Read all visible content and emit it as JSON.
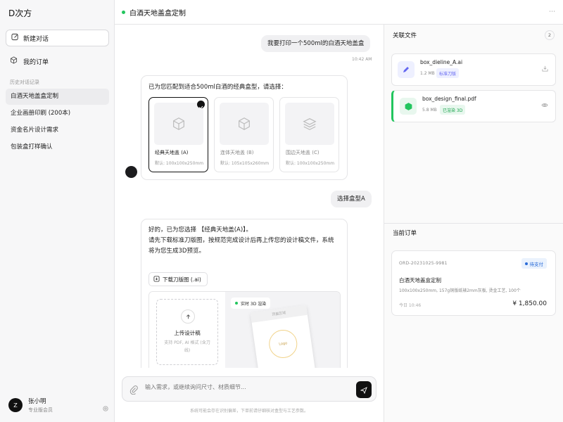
{
  "sidebar": {
    "brand": "D次方",
    "new_chat": "新建对话",
    "my_orders": "我的订单",
    "history_title": "历史对话记录",
    "history": [
      {
        "label": "白酒天地盖盒定制"
      },
      {
        "label": "企业画册印刷 (200本)"
      },
      {
        "label": "资金名片设计需求"
      },
      {
        "label": "包装盒打样确认"
      }
    ],
    "user": {
      "avatar": "Z",
      "name": "张小明",
      "role": "专业版会员"
    }
  },
  "header": {
    "title": "白酒天地盖盒定制",
    "more": "⋯"
  },
  "chat": {
    "user_msg_1": "我要打印一个500ml的白酒天地盖盒",
    "user_msg_1_time": "10:42 AM",
    "bot_msg_1": "已为您匹配到适合500ml白酒的经典盒型，请选择：",
    "options": [
      {
        "name": "经典天地盖 (A)",
        "dims": "默认: 100x100x250mm"
      },
      {
        "name": "连体天地盖 (B)",
        "dims": "默认: 105x105x260mm"
      },
      {
        "name": "围边天地盖 (C)",
        "dims": "默认: 100x100x250mm"
      }
    ],
    "user_msg_2": "选择盒型A",
    "bot_msg_2_line1": "好的，已为您选择 【经典天地盖(A)】。",
    "bot_msg_2_line2": "请先下载标准刀版图，按规范完成设计后再上传您的设计稿文件，系统",
    "bot_msg_2_line3": "将为您生成3D预览。",
    "download_label": "下载刀版图 (.ai)",
    "upload_title": "上传设计稿",
    "upload_sub": "支持 PDF, AI 格式 (含刀线)",
    "render_badge": "实时 3D 渲染",
    "box_top_text": "顶盖区域",
    "box_logo": "Logo"
  },
  "input": {
    "placeholder": "输入需求，或继续询问尺寸、材质细节...",
    "hint": "系统可能会存在识别偏差，下单前请仔细核对盒型与工艺参数。"
  },
  "files": {
    "title": "关联文件",
    "count": "2",
    "items": [
      {
        "name": "box_dieline_A.ai",
        "size": "1.2 MB",
        "tag": "标准刀版",
        "tag_color": "#6366f1",
        "icon": "pen-icon"
      },
      {
        "name": "box_design_final.pdf",
        "size": "5.8 MB",
        "tag": "已渲染 3D",
        "tag_color": "#22c55e",
        "icon": "cube-icon"
      }
    ]
  },
  "order": {
    "title": "当前订单",
    "number": "ORD-20231025-9981",
    "status": "待支付",
    "product": "白酒天地盖盒定制",
    "desc": "100x100x250mm, 157g铜版纸裱2mm灰板, 烫金工艺, 100个",
    "time": "今日 10:46",
    "price": "¥ 1,850.00"
  },
  "colors": {
    "accent": "#111111",
    "green": "#22c55e",
    "blue": "#2b6cd8"
  }
}
